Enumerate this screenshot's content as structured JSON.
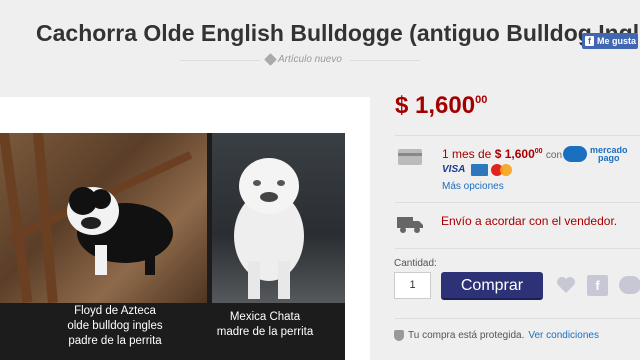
{
  "listing": {
    "title": "Cachorra Olde English Bulldogge (antiguo Bulldog Ingles)",
    "condition": "Artículo nuevo",
    "facebook_label": "Me gusta",
    "price": {
      "symbol": "$",
      "amount": "1,600",
      "cents": "00"
    }
  },
  "gallery": {
    "caption_left": [
      "Floyd de Azteca",
      "olde bulldog ingles",
      "padre de la perrita"
    ],
    "caption_right": [
      "Mexica Chata",
      "madre de la perrita"
    ]
  },
  "payment": {
    "installment_prefix": "1 mes de",
    "installment_amount": "$ 1,600",
    "installment_cents": "00",
    "with_label": "con",
    "provider_line1": "mercado",
    "provider_line2": "pago",
    "visa_label": "VISA",
    "more_options": "Más opciones"
  },
  "shipping": {
    "text": "Envío a acordar con el vendedor."
  },
  "purchase": {
    "quantity_label": "Cantidad:",
    "quantity_value": "1",
    "buy_label": "Comprar"
  },
  "protection": {
    "text": "Tu compra está protegida.",
    "link": "Ver condiciones"
  },
  "colors": {
    "price": "#a50000",
    "buy_button": "#2d3176",
    "link": "#1a6fc1",
    "facebook": "#4267b2"
  },
  "icons": [
    "tag-icon",
    "card-icon",
    "truck-icon",
    "heart-icon",
    "bookmark-icon",
    "chat-icon",
    "shield-icon"
  ]
}
